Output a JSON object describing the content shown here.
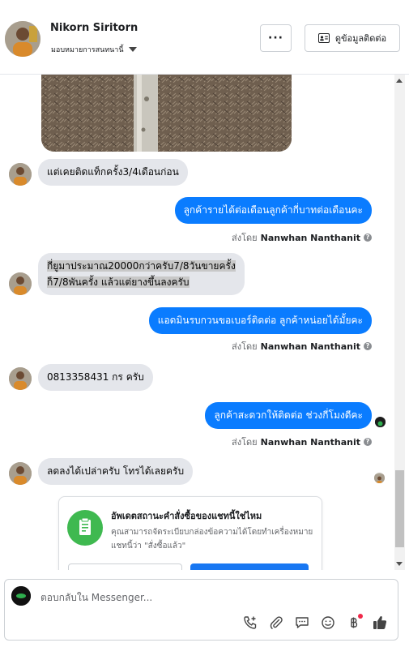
{
  "header": {
    "contact_name": "Nikorn Siritorn",
    "assign_label": "มอบหมายการสนทนานี้",
    "more_label": "···",
    "contact_info_label": "ดูข้อมูลติดต่อ"
  },
  "messages": [
    {
      "id": "m1",
      "direction": "in",
      "text": "แต่เคยติดแท็กครั้ง3/4เดือนก่อน"
    },
    {
      "id": "m2",
      "direction": "out",
      "text": "ลูกค้ารายได้ต่อเดือนลูกค้ากี่บาทต่อเดือนคะ"
    },
    {
      "id": "m3",
      "direction": "in",
      "lines": [
        "กี่ยูมาประมาณ20000กว่าครับ7/8วันขายครั้ง",
        "ก็7/8พันครั้ง แล้วแต่ยางขึ้นลงครับ"
      ]
    },
    {
      "id": "m4",
      "direction": "out",
      "text": "แอดมินรบกวนขอเบอร์ติดต่อ ลูกค้าหน่อยได้มั้ยคะ"
    },
    {
      "id": "m5",
      "direction": "in",
      "text": "0813358431 กร ครับ"
    },
    {
      "id": "m6",
      "direction": "out",
      "text": "ลูกค้าสะดวกให้ติดต่อ ช่วงกี่โมงดีคะ"
    },
    {
      "id": "m7",
      "direction": "in",
      "text": "ลดลงได้เปล่าครับ โทรได้เลยครับ"
    }
  ],
  "sent_by": {
    "prefix": "ส่งโดย",
    "name": "Nanwhan Nanthanit",
    "info_icon": "?"
  },
  "order_card": {
    "title": "อัพเดตสถานะคำสั่งซื้อของแชทนี้ใช่ไหม",
    "body": "คุณสามารถจัดระเบียบกล่องข้อความได้โดยทำเครื่องหมายแชทนี้ว่า \"สั่งซื้อแล้ว\""
  },
  "composer": {
    "placeholder": "ตอบกลับใน Messenger..."
  },
  "icons": {
    "call_add": "phone-plus-icon",
    "attach": "paperclip-icon",
    "saved_reply": "chat-bubble-icon",
    "emoji": "smiley-icon",
    "payment": "baht-icon",
    "like": "thumbs-up-icon"
  },
  "colors": {
    "outgoing_bubble": "#0a7cff",
    "incoming_bubble": "#e4e6eb",
    "card_icon": "#3fb950",
    "primary_button": "#1877f2"
  }
}
